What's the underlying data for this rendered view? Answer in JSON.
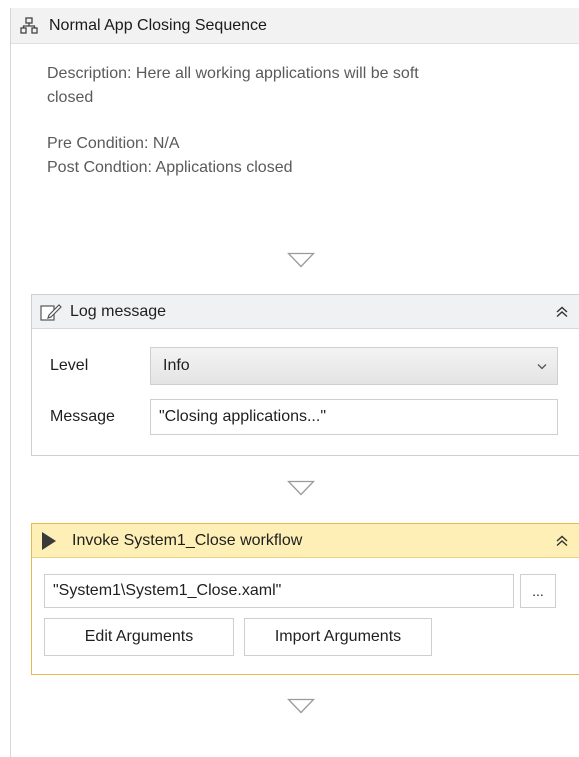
{
  "sequence": {
    "title": "Normal App Closing Sequence",
    "icon": "sequence-icon",
    "annotation": {
      "description_line1": "Description: Here all working applications will be soft",
      "description_line2": "closed",
      "pre_condition": "Pre Condition: N/A",
      "post_condition": "Post Condtion: Applications closed"
    }
  },
  "log_message": {
    "title": "Log message",
    "icon": "log-message-icon",
    "level_label": "Level",
    "level_value": "Info",
    "message_label": "Message",
    "message_value": "\"Closing applications...\""
  },
  "invoke": {
    "title": "Invoke System1_Close workflow",
    "icon": "play-icon",
    "accent_color": "#fdefb5",
    "path_value": "\"System1\\System1_Close.xaml\"",
    "browse_label": "...",
    "edit_args_label": "Edit Arguments",
    "import_args_label": "Import Arguments"
  }
}
